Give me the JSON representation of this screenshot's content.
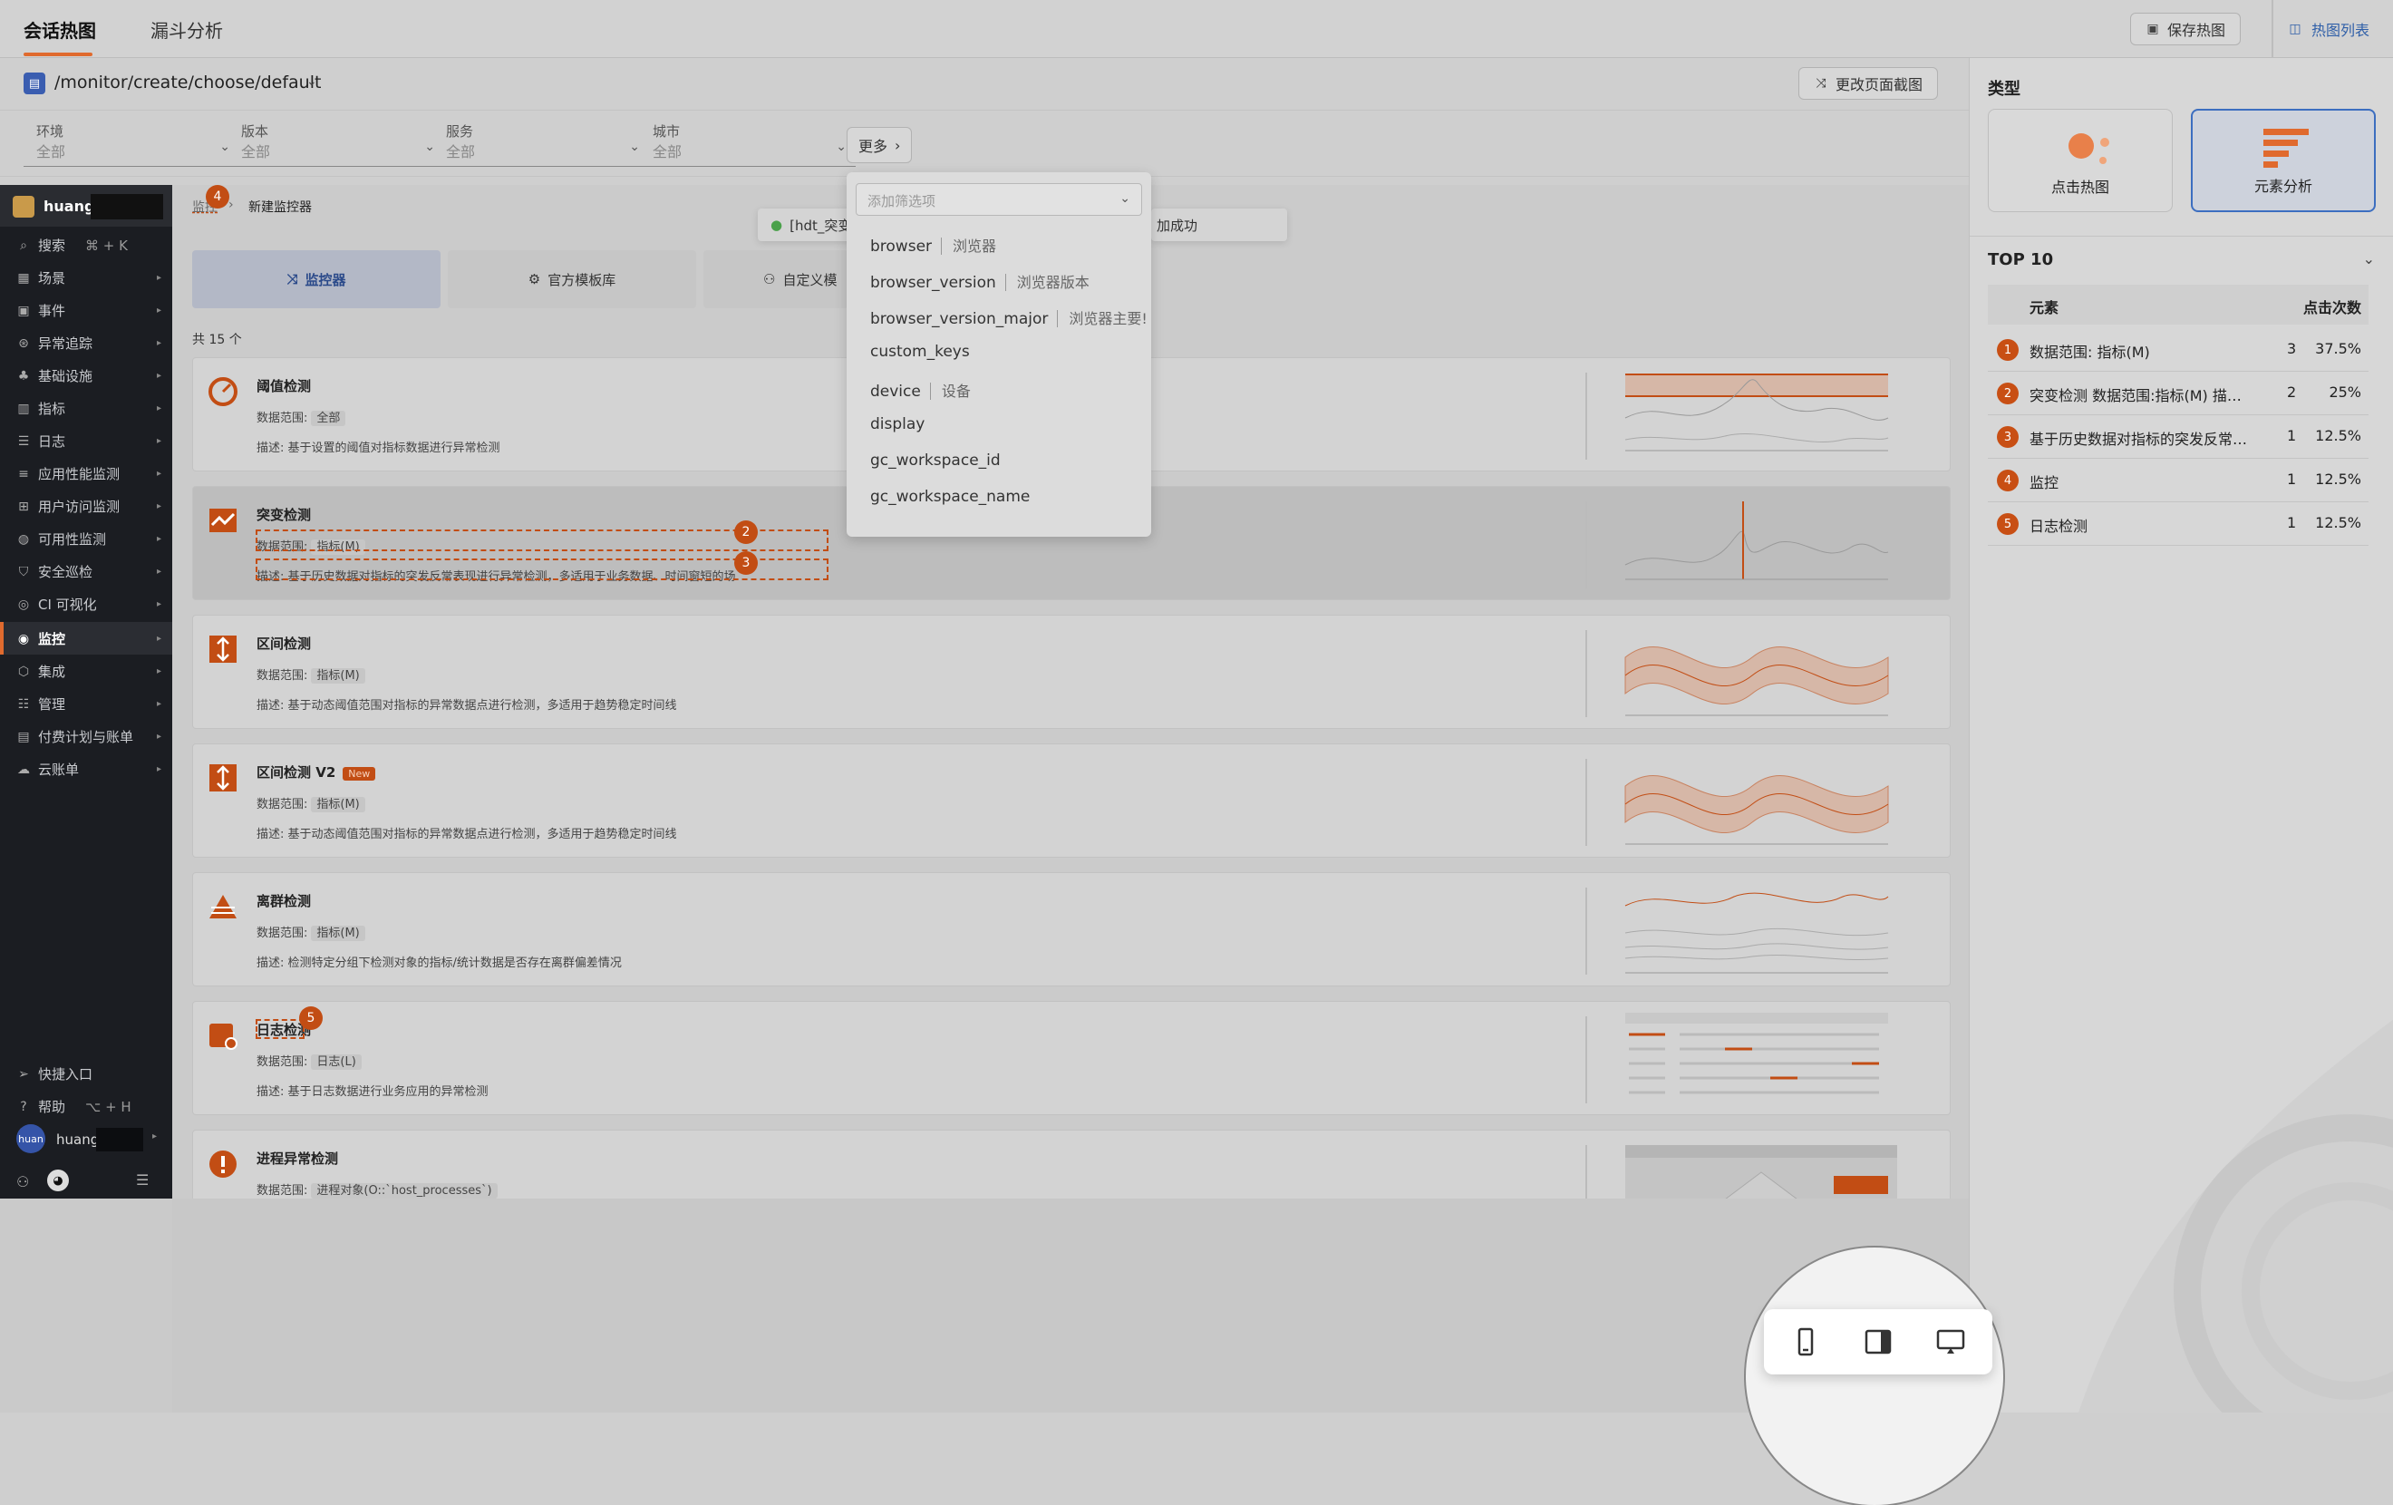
{
  "topbar": {
    "tabs": [
      {
        "label": "会话热图"
      },
      {
        "label": "漏斗分析"
      }
    ],
    "save_label": "保存热图",
    "list_label": "热图列表"
  },
  "urlbar": {
    "path": "/monitor/create/choose/default",
    "change_screenshot_label": "更改页面截图"
  },
  "filters": [
    {
      "label": "环境",
      "value": "全部"
    },
    {
      "label": "版本",
      "value": "全部"
    },
    {
      "label": "服务",
      "value": "全部"
    },
    {
      "label": "城市",
      "value": "全部"
    }
  ],
  "more_label": "更多",
  "dropdown": {
    "placeholder": "添加筛选项",
    "items": [
      {
        "key": "browser",
        "desc": "浏览器"
      },
      {
        "key": "browser_version",
        "desc": "浏览器版本"
      },
      {
        "key": "browser_version_major",
        "desc": "浏览器主要!"
      },
      {
        "key": "custom_keys",
        "desc": ""
      },
      {
        "key": "device",
        "desc": "设备"
      },
      {
        "key": "display",
        "desc": ""
      },
      {
        "key": "gc_workspace_id",
        "desc": ""
      },
      {
        "key": "gc_workspace_name",
        "desc": ""
      }
    ]
  },
  "sidebar": {
    "user": "huang",
    "search": "搜索",
    "search_shortcut": "⌘ + K",
    "items": [
      {
        "label": "场景"
      },
      {
        "label": "事件"
      },
      {
        "label": "异常追踪"
      },
      {
        "label": "基础设施"
      },
      {
        "label": "指标"
      },
      {
        "label": "日志"
      },
      {
        "label": "应用性能监测"
      },
      {
        "label": "用户访问监测"
      },
      {
        "label": "可用性监测"
      },
      {
        "label": "安全巡检"
      },
      {
        "label": "CI 可视化"
      },
      {
        "label": "监控"
      },
      {
        "label": "集成"
      },
      {
        "label": "管理"
      },
      {
        "label": "付费计划与账单"
      },
      {
        "label": "云账单"
      }
    ],
    "quick_entry": "快捷入口",
    "help": "帮助",
    "help_shortcut": "⌥ + H",
    "avatar_text": "huan",
    "bottom_user": "huang"
  },
  "content": {
    "breadcrumb_root": "监控",
    "breadcrumb_current": "新建监控器",
    "toast_left": "[hdt_突变",
    "toast_right": "加成功",
    "template_tabs": [
      {
        "label": "监控器"
      },
      {
        "label": "官方模板库"
      },
      {
        "label": "自定义模"
      }
    ],
    "count": "共 15 个",
    "range_prefix": "数据范围:",
    "desc_prefix": "描述:",
    "new_badge": "New",
    "cards": [
      {
        "title": "阈值检测",
        "range": "全部",
        "desc": "基于设置的阈值对指标数据进行异常检测"
      },
      {
        "title": "突变检测",
        "range": "指标(M)",
        "desc": "基于历史数据对指标的突发反常表现进行异常检测，多适用于业务数据、时间窗短的场"
      },
      {
        "title": "区间检测",
        "range": "指标(M)",
        "desc": "基于动态阈值范围对指标的异常数据点进行检测，多适用于趋势稳定时间线"
      },
      {
        "title": "区间检测 V2",
        "range": "指标(M)",
        "desc": "基于动态阈值范围对指标的异常数据点进行检测，多适用于趋势稳定时间线"
      },
      {
        "title": "离群检测",
        "range": "指标(M)",
        "desc": "检测特定分组下检测对象的指标/统计数据是否存在离群偏差情况"
      },
      {
        "title": "日志检测",
        "range": "日志(L)",
        "desc": "基于日志数据进行业务应用的异常检测"
      },
      {
        "title": "进程异常检测",
        "range": "进程对象(O::`host_processes`)",
        "desc": ""
      }
    ],
    "badges": [
      "2",
      "3",
      "4",
      "5"
    ]
  },
  "rightpanel": {
    "type_title": "类型",
    "types": [
      {
        "label": "点击热图"
      },
      {
        "label": "元素分析"
      }
    ],
    "top_title": "TOP 10",
    "col_element": "元素",
    "col_clicks": "点击次数",
    "rows": [
      {
        "rank": "1",
        "name": "数据范围: 指标(M)",
        "count": "3",
        "pct": "37.5%"
      },
      {
        "rank": "2",
        "name": "突变检测 数据范围:指标(M) 描述:基于历史数据",
        "count": "2",
        "pct": "25%"
      },
      {
        "rank": "3",
        "name": "基于历史数据对指标的突发反常表现进行异常检测",
        "count": "1",
        "pct": "12.5%"
      },
      {
        "rank": "4",
        "name": "监控",
        "count": "1",
        "pct": "12.5%"
      },
      {
        "rank": "5",
        "name": "日志检测",
        "count": "1",
        "pct": "12.5%"
      }
    ]
  },
  "colors": {
    "accent": "#e06a2e",
    "badge": "#c24d14",
    "active_blue": "#3c6ec0"
  }
}
